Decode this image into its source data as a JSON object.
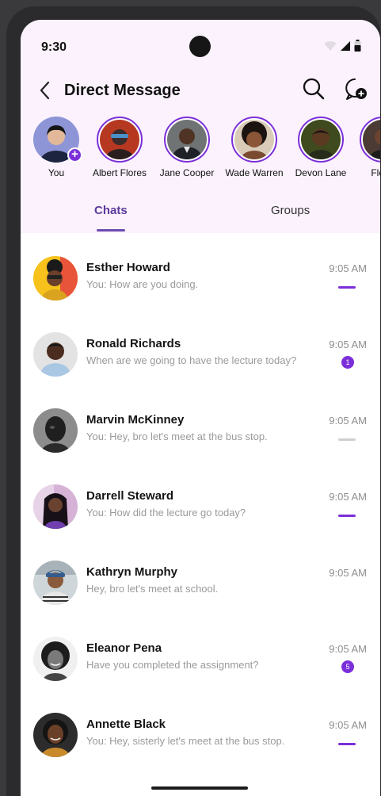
{
  "status": {
    "time": "9:30"
  },
  "header": {
    "title": "Direct Message"
  },
  "stories": [
    {
      "name": "You"
    },
    {
      "name": "Albert Flores"
    },
    {
      "name": "Jane Cooper"
    },
    {
      "name": "Wade Warren"
    },
    {
      "name": "Devon Lane"
    },
    {
      "name": "Floyd"
    }
  ],
  "tabs": {
    "chats": "Chats",
    "groups": "Groups"
  },
  "chats": [
    {
      "name": "Esther Howard",
      "preview": "You: How are you doing.",
      "time": "9:05 AM",
      "indicator": "dash"
    },
    {
      "name": "Ronald Richards",
      "preview": "When are we going to have the lecture today?",
      "time": "9:05 AM",
      "indicator": "count",
      "count": "1"
    },
    {
      "name": "Marvin McKinney",
      "preview": "You: Hey, bro let's meet at the bus stop.",
      "time": "9:05 AM",
      "indicator": "dash-grey"
    },
    {
      "name": "Darrell Steward",
      "preview": "You: How did the lecture go today?",
      "time": "9:05 AM",
      "indicator": "dash"
    },
    {
      "name": "Kathryn Murphy",
      "preview": "Hey, bro let's meet at school.",
      "time": "9:05 AM",
      "indicator": "none"
    },
    {
      "name": "Eleanor Pena",
      "preview": "Have you completed the assignment?",
      "time": "9:05 AM",
      "indicator": "count",
      "count": "5"
    },
    {
      "name": "Annette Black",
      "preview": "You: Hey, sisterly let's meet at the bus stop.",
      "time": "9:05 AM",
      "indicator": "dash"
    }
  ],
  "colors": {
    "accent": "#7b2fd9",
    "header_bg": "#fbf2fd",
    "tab_active": "#5b3a9c"
  }
}
